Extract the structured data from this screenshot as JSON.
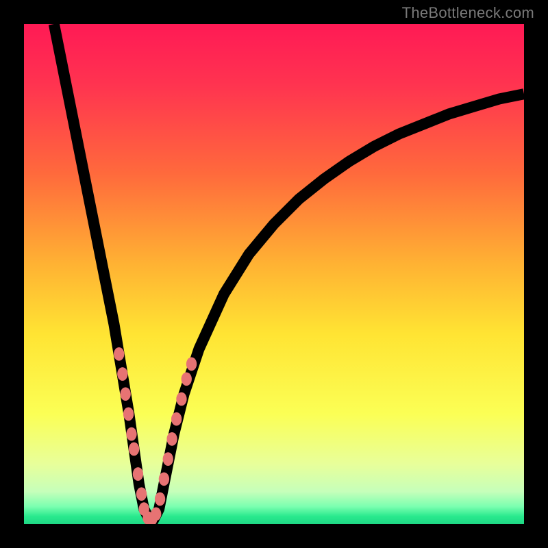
{
  "watermark": "TheBottleneck.com",
  "chart_data": {
    "type": "line",
    "title": "",
    "xlabel": "",
    "ylabel": "",
    "xlim": [
      0,
      100
    ],
    "ylim": [
      0,
      100
    ],
    "grid": false,
    "legend": false,
    "gradient_stops": [
      {
        "pos": 0.0,
        "color": "#ff1a55"
      },
      {
        "pos": 0.12,
        "color": "#ff3350"
      },
      {
        "pos": 0.3,
        "color": "#ff6a3c"
      },
      {
        "pos": 0.48,
        "color": "#ffb233"
      },
      {
        "pos": 0.62,
        "color": "#ffe433"
      },
      {
        "pos": 0.78,
        "color": "#fbff55"
      },
      {
        "pos": 0.88,
        "color": "#e8ff9a"
      },
      {
        "pos": 0.935,
        "color": "#c6ffba"
      },
      {
        "pos": 0.965,
        "color": "#7bffb0"
      },
      {
        "pos": 0.985,
        "color": "#28e98d"
      },
      {
        "pos": 1.0,
        "color": "#1fd885"
      }
    ],
    "series": [
      {
        "name": "bottleneck-curve",
        "x": [
          6,
          8,
          10,
          12,
          14,
          16,
          18,
          19,
          20,
          21,
          22,
          23,
          24,
          25,
          26,
          27,
          28,
          30,
          32,
          35,
          40,
          45,
          50,
          55,
          60,
          65,
          70,
          75,
          80,
          85,
          90,
          95,
          100
        ],
        "y": [
          100,
          90,
          80,
          70,
          60,
          50,
          40,
          34,
          28,
          22,
          15,
          8,
          3,
          1,
          1,
          3,
          8,
          18,
          26,
          35,
          46,
          54,
          60,
          65,
          69,
          72.5,
          75.5,
          78,
          80,
          82,
          83.5,
          85,
          86
        ]
      }
    ],
    "markers": {
      "name": "highlighted-points",
      "color": "#e77373",
      "points": [
        {
          "x": 19.0,
          "y": 34
        },
        {
          "x": 19.7,
          "y": 30
        },
        {
          "x": 20.3,
          "y": 26
        },
        {
          "x": 20.9,
          "y": 22
        },
        {
          "x": 21.5,
          "y": 18
        },
        {
          "x": 22.0,
          "y": 15
        },
        {
          "x": 22.8,
          "y": 10
        },
        {
          "x": 23.5,
          "y": 6
        },
        {
          "x": 24.0,
          "y": 3
        },
        {
          "x": 24.8,
          "y": 1.2
        },
        {
          "x": 25.6,
          "y": 1.0
        },
        {
          "x": 26.4,
          "y": 2.0
        },
        {
          "x": 27.2,
          "y": 5
        },
        {
          "x": 28.0,
          "y": 9
        },
        {
          "x": 28.8,
          "y": 13
        },
        {
          "x": 29.6,
          "y": 17
        },
        {
          "x": 30.5,
          "y": 21
        },
        {
          "x": 31.5,
          "y": 25
        },
        {
          "x": 32.5,
          "y": 29
        },
        {
          "x": 33.5,
          "y": 32
        }
      ]
    }
  }
}
